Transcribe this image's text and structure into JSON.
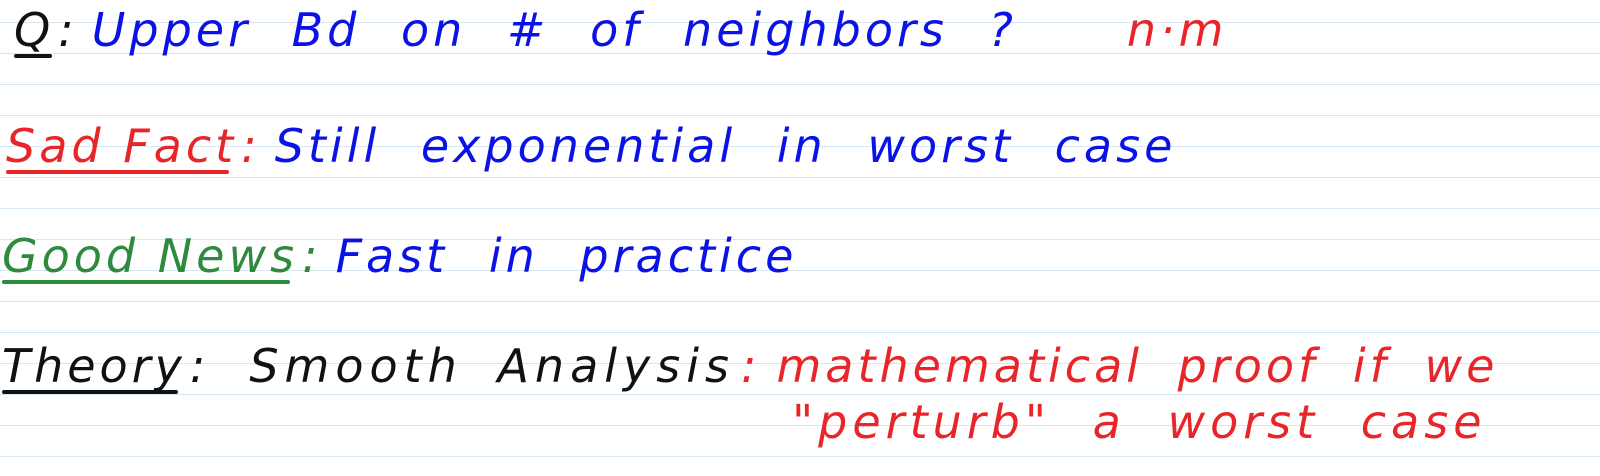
{
  "colors": {
    "blue_ink": "#0a12e6",
    "red_ink": "#e8262a",
    "green_ink": "#2e8a3c",
    "black_ink": "#111111",
    "ruling": "#d6e6f3"
  },
  "notes": {
    "question": {
      "label": "Q",
      "colon": ":",
      "text": "Upper Bd on # of neighbors ?",
      "annotation": "n·m"
    },
    "sad_fact": {
      "label": "Sad Fact",
      "colon": ":",
      "text": "Still exponential in worst case"
    },
    "good_news": {
      "label": "Good News",
      "colon": ":",
      "text": "Fast in practice"
    },
    "theory": {
      "label": "Theory",
      "colon": ":",
      "text": "Smooth Analysis",
      "colon2": ":",
      "definition_line1": "mathematical proof if we",
      "definition_line2": "\"perturb\" a worst case"
    }
  }
}
